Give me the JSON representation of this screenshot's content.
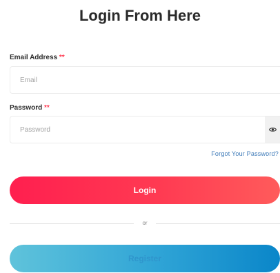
{
  "form": {
    "title": "Login From Here",
    "email": {
      "label": "Email Address",
      "required_mark": "**",
      "placeholder": "Email",
      "value": ""
    },
    "password": {
      "label": "Password",
      "required_mark": "**",
      "placeholder": "Password",
      "value": "",
      "toggle_icon": "eye-icon"
    },
    "forgot_link": "Forgot Your Password?",
    "login_button": "Login",
    "divider_text": "or",
    "register_button": "Register"
  },
  "colors": {
    "login_gradient": [
      "#ff1f4f",
      "#ff5b5b"
    ],
    "register_gradient": [
      "#5fc3db",
      "#0a86c9"
    ],
    "required": "#ff3b52",
    "link": "#3d7ab8"
  }
}
